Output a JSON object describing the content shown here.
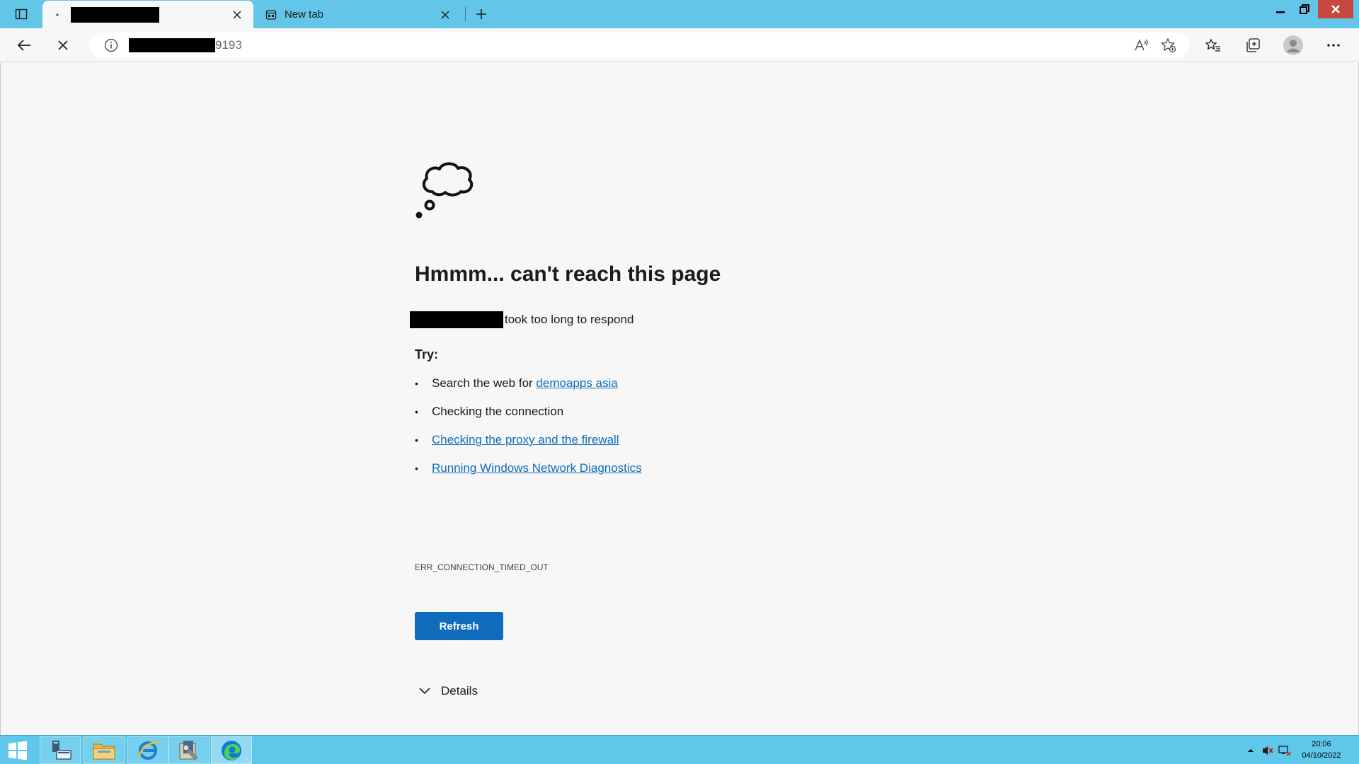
{
  "tabs": [
    {
      "title": "",
      "close_label": "×",
      "active": true
    },
    {
      "title": "New tab",
      "close_label": "×",
      "active": false
    }
  ],
  "toolbar": {
    "url_suffix": "9193",
    "icons": [
      "back-icon",
      "stop-icon",
      "site-info-icon",
      "read-aloud-icon",
      "add-favorite-icon",
      "favorites-icon",
      "collections-icon",
      "profile-icon",
      "more-icon"
    ]
  },
  "error_page": {
    "headline": "Hmmm... can't reach this page",
    "subline": "took too long to respond",
    "try_label": "Try:",
    "suggestions": [
      {
        "prefix": "Search the web for ",
        "link": "demoapps asia"
      },
      {
        "prefix": "Checking the connection",
        "link": ""
      },
      {
        "prefix": "",
        "link": "Checking the proxy and the firewall"
      },
      {
        "prefix": "",
        "link": "Running Windows Network Diagnostics"
      }
    ],
    "error_code": "ERR_CONNECTION_TIMED_OUT",
    "refresh_label": "Refresh",
    "details_label": "Details"
  },
  "taskbar": {
    "time": "20:06",
    "date": "04/10/2022",
    "apps": [
      "server-manager-icon",
      "file-explorer-icon",
      "internet-explorer-icon",
      "admin-tools-icon",
      "edge-icon"
    ]
  },
  "colors": {
    "titlebar": "#63c6e9",
    "link": "#0f6cbd",
    "button": "#0f6cbd",
    "taskbar": "#5fc7ea"
  }
}
